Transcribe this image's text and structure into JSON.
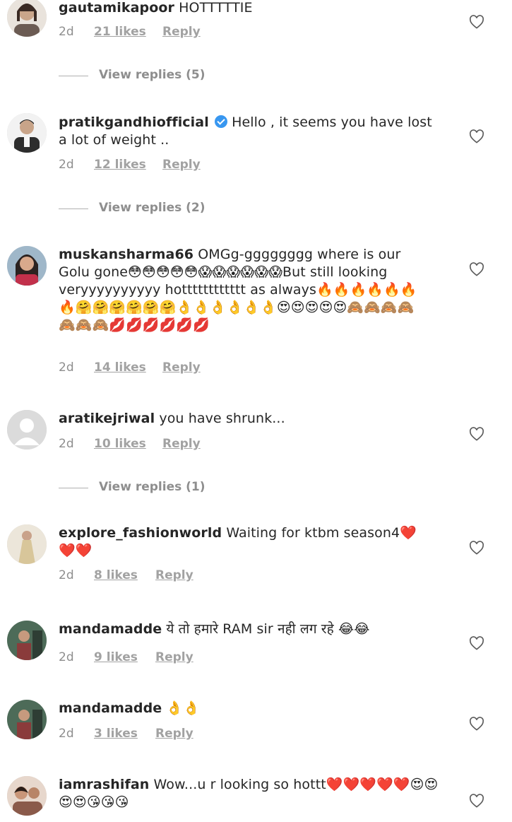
{
  "comments": [
    {
      "username": "gautamikapoor",
      "text": "HOTTTTTIE",
      "age": "2d",
      "likes": "21 likes",
      "reply": "Reply",
      "verified": false,
      "view_replies": "View replies (5)",
      "avatar_color": "#6b5b53"
    },
    {
      "username": "pratikgandhiofficial",
      "text": "Hello , it seems you have lost a lot of weight ..",
      "age": "2d",
      "likes": "12 likes",
      "reply": "Reply",
      "verified": true,
      "view_replies": "View replies (2)",
      "avatar_color": "#3a3a3a"
    },
    {
      "username": "muskansharma66",
      "text": "OMGg-gggggggg where is our Golu gone😳😳😳😳😳😱😱😱😱😱😱But still looking veryyyyyyyyyy hotttttttttttt as always🔥🔥🔥🔥🔥🔥🔥🤗🤗🤗🤗🤗🤗👌👌👌👌👌👌😍😍😍😍😍🙈🙈🙈🙈🙈🙈🙈💋💋💋💋💋💋",
      "age": "2d",
      "likes": "14 likes",
      "reply": "Reply",
      "verified": false,
      "view_replies": "",
      "avatar_color": "#4a3b38"
    },
    {
      "username": "aratikejriwal",
      "text": "you have shrunk...",
      "age": "2d",
      "likes": "10 likes",
      "reply": "Reply",
      "verified": false,
      "view_replies": "View replies (1)",
      "avatar_color": "#dbdbdb"
    },
    {
      "username": "explore_fashionworld",
      "text": "Waiting for ktbm season4❤️❤️❤️",
      "age": "2d",
      "likes": "8 likes",
      "reply": "Reply",
      "verified": false,
      "view_replies": "",
      "avatar_color": "#c9b98f"
    },
    {
      "username": "mandamadde",
      "text": "ये तो हमारे RAM sir नही लग रहे 😂😂",
      "age": "2d",
      "likes": "9 likes",
      "reply": "Reply",
      "verified": false,
      "view_replies": "",
      "avatar_color": "#3e5a4a"
    },
    {
      "username": "mandamadde",
      "text": "👌👌",
      "age": "2d",
      "likes": "3 likes",
      "reply": "Reply",
      "verified": false,
      "view_replies": "",
      "avatar_color": "#3e5a4a"
    },
    {
      "username": "iamrashifan",
      "text": "Wow...u r looking so hottt❤️❤️❤️❤️❤️😍😍😍😍😘😘😘",
      "age": "",
      "likes": "",
      "reply": "",
      "verified": false,
      "view_replies": "",
      "avatar_color": "#8a5a4a"
    }
  ],
  "icons": {
    "like": "heart-outline-icon",
    "verified": "verified-badge-icon",
    "avatar_placeholder": "default-avatar-icon"
  }
}
